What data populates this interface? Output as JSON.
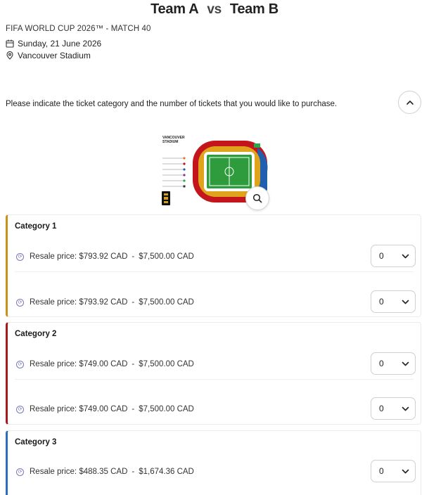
{
  "header": {
    "team_a": "Team A",
    "vs": "vs",
    "team_b": "Team B",
    "match": "FIFA WORLD CUP 2026™ - MATCH 40",
    "date": "Sunday, 21 June 2026",
    "venue": "Vancouver Stadium"
  },
  "instructions": "Please indicate the ticket category and the number of tickets that you would like to purchase.",
  "map": {
    "title_line1": "VANCOUVER",
    "title_line2": "STADIUM"
  },
  "colors": {
    "category_1": "#c8921a",
    "category_2": "#a8191c",
    "category_3": "#2a6fb8"
  },
  "categories": [
    {
      "name": "Category 1",
      "rows": [
        {
          "label": "Resale price:",
          "min": "$793.92 CAD",
          "dash": "-",
          "max": "$7,500.00 CAD",
          "qty": "0"
        },
        {
          "label": "Resale price:",
          "min": "$793.92 CAD",
          "dash": "-",
          "max": "$7,500.00 CAD",
          "qty": "0"
        }
      ]
    },
    {
      "name": "Category 2",
      "rows": [
        {
          "label": "Resale price:",
          "min": "$749.00 CAD",
          "dash": "-",
          "max": "$7,500.00 CAD",
          "qty": "0"
        },
        {
          "label": "Resale price:",
          "min": "$749.00 CAD",
          "dash": "-",
          "max": "$7,500.00 CAD",
          "qty": "0"
        }
      ]
    },
    {
      "name": "Category 3",
      "rows": [
        {
          "label": "Resale price:",
          "min": "$488.35 CAD",
          "dash": "-",
          "max": "$1,674.36 CAD",
          "qty": "0"
        }
      ]
    }
  ]
}
